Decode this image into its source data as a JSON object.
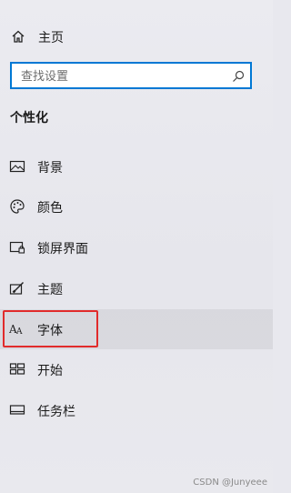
{
  "home": {
    "label": "主页",
    "icon": "home-icon"
  },
  "search": {
    "placeholder": "查找设置",
    "icon": "search-icon"
  },
  "section": {
    "title": "个性化"
  },
  "nav": {
    "items": [
      {
        "id": "background",
        "label": "背景",
        "icon": "picture-icon"
      },
      {
        "id": "colors",
        "label": "颜色",
        "icon": "palette-icon"
      },
      {
        "id": "lock-screen",
        "label": "锁屏界面",
        "icon": "lock-screen-icon"
      },
      {
        "id": "themes",
        "label": "主题",
        "icon": "paintbrush-icon"
      },
      {
        "id": "fonts",
        "label": "字体",
        "icon": "font-icon",
        "selected": true
      },
      {
        "id": "start",
        "label": "开始",
        "icon": "start-icon"
      },
      {
        "id": "taskbar",
        "label": "任务栏",
        "icon": "taskbar-icon"
      }
    ]
  },
  "highlight": {
    "color": "#e12b2b"
  },
  "accent": {
    "search_border": "#0078d4"
  },
  "watermark": {
    "text": "CSDN @Junyeee"
  }
}
